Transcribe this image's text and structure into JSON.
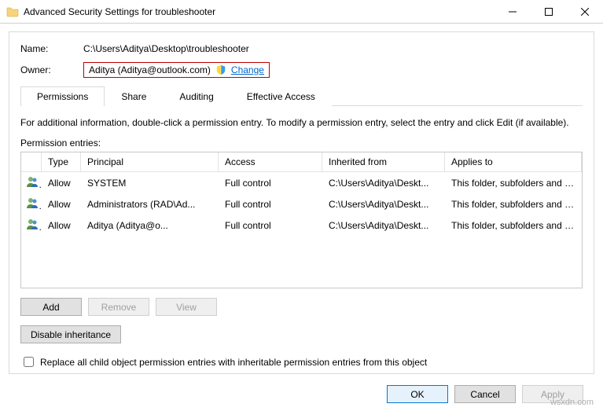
{
  "window": {
    "title": "Advanced Security Settings for troubleshooter"
  },
  "fields": {
    "name_label": "Name:",
    "name_value": "C:\\Users\\Aditya\\Desktop\\troubleshooter",
    "owner_label": "Owner:",
    "owner_value": "Aditya (Aditya@outlook.com)",
    "change_link": "Change"
  },
  "tabs": {
    "permissions": "Permissions",
    "share": "Share",
    "auditing": "Auditing",
    "effective": "Effective Access"
  },
  "info_text": "For additional information, double-click a permission entry. To modify a permission entry, select the entry and click Edit (if available).",
  "entries_label": "Permission entries:",
  "columns": {
    "type": "Type",
    "principal": "Principal",
    "access": "Access",
    "inherited": "Inherited from",
    "applies": "Applies to"
  },
  "rows": [
    {
      "type": "Allow",
      "principal": "SYSTEM",
      "access": "Full control",
      "inherited": "C:\\Users\\Aditya\\Deskt...",
      "applies": "This folder, subfolders and files"
    },
    {
      "type": "Allow",
      "principal": "Administrators (RAD\\Ad...",
      "access": "Full control",
      "inherited": "C:\\Users\\Aditya\\Deskt...",
      "applies": "This folder, subfolders and files"
    },
    {
      "type": "Allow",
      "principal": "Aditya (Aditya@o...",
      "access": "Full control",
      "inherited": "C:\\Users\\Aditya\\Deskt...",
      "applies": "This folder, subfolders and files"
    }
  ],
  "buttons": {
    "add": "Add",
    "remove": "Remove",
    "view": "View",
    "disable_inheritance": "Disable inheritance",
    "ok": "OK",
    "cancel": "Cancel",
    "apply": "Apply"
  },
  "checkbox_label": "Replace all child object permission entries with inheritable permission entries from this object",
  "watermark": "wsxdn.com"
}
